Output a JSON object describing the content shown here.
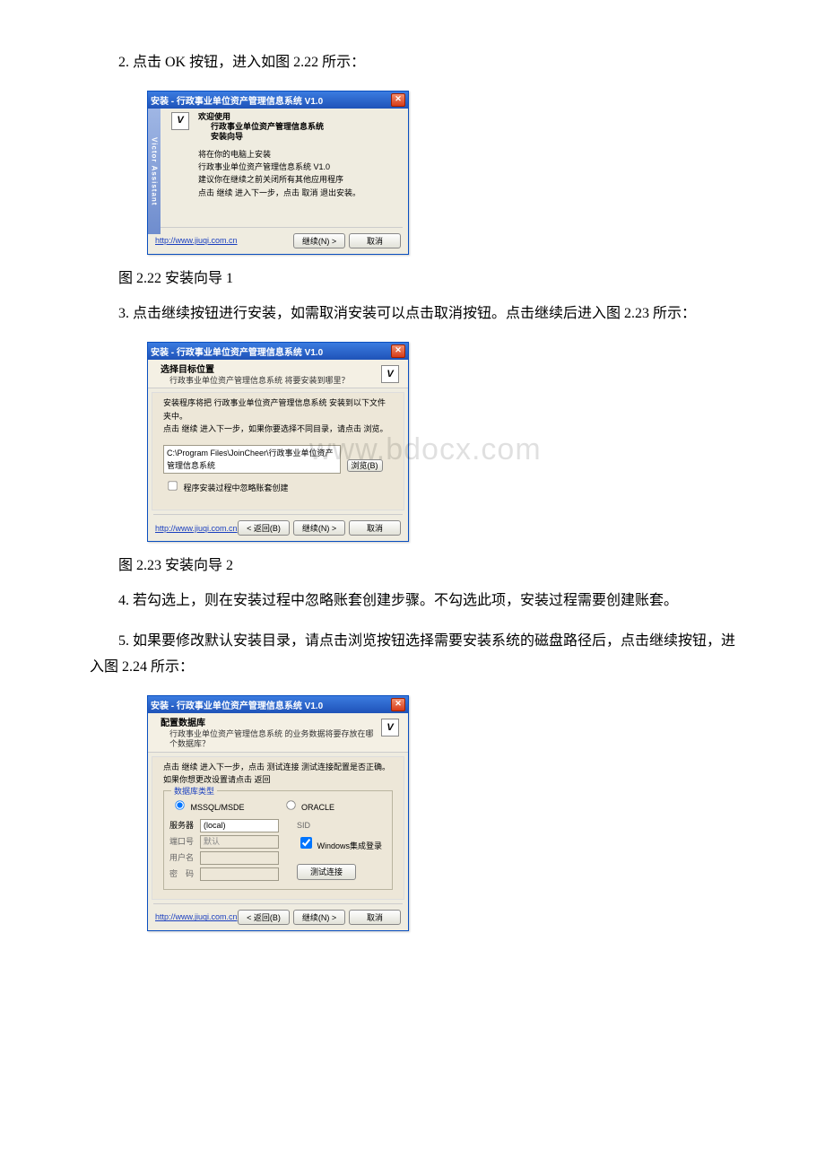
{
  "text": {
    "p1": "2. 点击 OK 按钮，进入如图 2.22 所示：",
    "cap1": "图 2.22 安装向导 1",
    "p2": "3. 点击继续按钮进行安装，如需取消安装可以点击取消按钮。点击继续后进入图 2.23 所示：",
    "cap2": "图 2.23 安装向导 2",
    "p3": "4. 若勾选上，则在安装过程中忽略账套创建步骤。不勾选此项，安装过程需要创建账套。",
    "p4": "5. 如果要修改默认安装目录，请点击浏览按钮选择需要安装系统的磁盘路径后，点击继续按钮，进入图 2.24 所示：",
    "watermark": "www.bdocx.com"
  },
  "dlg1": {
    "title": "安装 - 行政事业单位资产管理信息系统 V1.0",
    "sidebar": "Victor Assistant",
    "welcome": "欢迎使用",
    "welcome2": "行政事业单位资产管理信息系统",
    "welcome3": "安装向导",
    "line1": "将在你的电脑上安装",
    "line2": "行政事业单位资产管理信息系统 V1.0",
    "line3": "建议你在继续之前关闭所有其他应用程序",
    "line4": "点击 继续 进入下一步，点击 取消 退出安装。",
    "url": "http://www.jiuqi.com.cn",
    "btn_next": "继续(N) >",
    "btn_cancel": "取消"
  },
  "dlg2": {
    "title": "安装 - 行政事业单位资产管理信息系统 V1.0",
    "head": "选择目标位置",
    "sub": "行政事业单位资产管理信息系统 将要安装到哪里？",
    "line1": "安装程序将把 行政事业单位资产管理信息系统 安装到以下文件夹中。",
    "line2": "点击 继续 进入下一步，如果你要选择不同目录，请点击 浏览。",
    "path": "C:\\Program Files\\JoinCheer\\行政事业单位资产管理信息系统",
    "browse": "浏览(B)",
    "chk": "程序安装过程中忽略账套创建",
    "url": "http://www.jiuqi.com.cn",
    "btn_back": "< 返回(B)",
    "btn_next": "继续(N) >",
    "btn_cancel": "取消"
  },
  "dlg3": {
    "title": "安装 - 行政事业单位资产管理信息系统 V1.0",
    "head": "配置数据库",
    "sub": "行政事业单位资产管理信息系统 的业务数据将要存放在哪个数据库？",
    "line1": "点击 继续 进入下一步，点击 测试连接 测试连接配置是否正确。",
    "line2": "如果你想更改设置请点击 返回",
    "group_label": "数据库类型",
    "radio1": "MSSQL/MSDE",
    "radio2": "ORACLE",
    "lbl_server": "服务器",
    "val_server": "(local)",
    "lbl_sid": "SID",
    "lbl_port": "端口号",
    "val_port": "默认",
    "chk_win": "Windows集成登录",
    "lbl_user": "用户名",
    "lbl_pwd": "密　码",
    "btn_test": "测试连接",
    "url": "http://www.jiuqi.com.cn",
    "btn_back": "< 返回(B)",
    "btn_next": "继续(N) >",
    "btn_cancel": "取消"
  }
}
